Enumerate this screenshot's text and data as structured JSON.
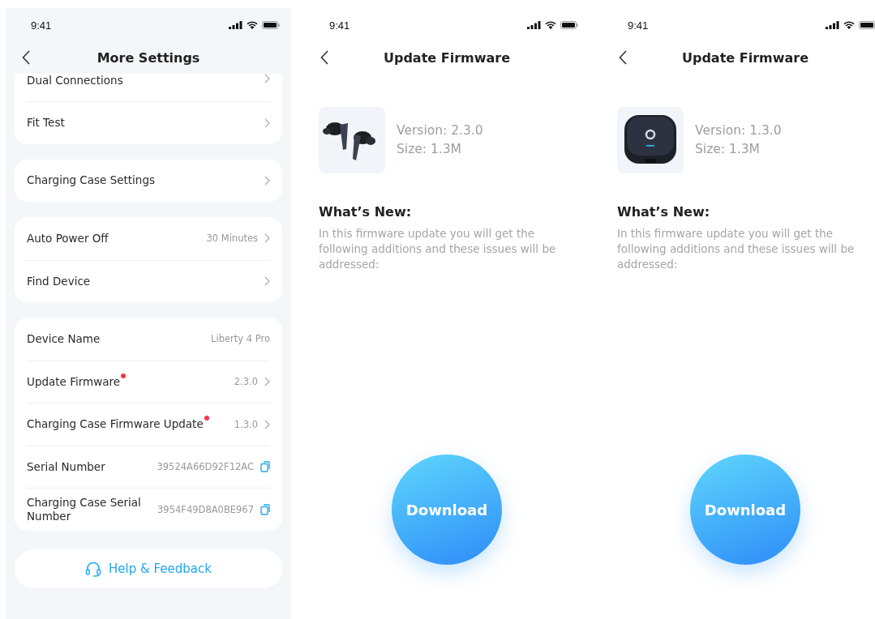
{
  "screens": [
    {
      "kind": "settings",
      "time": "9:41",
      "title": "More Settings",
      "groups": [
        {
          "rows": [
            {
              "kind": "link",
              "label": "Dual Connections",
              "badge": false
            },
            {
              "kind": "link",
              "label": "Fit Test",
              "badge": false
            }
          ]
        },
        {
          "rows": [
            {
              "kind": "link",
              "label": "Charging Case Settings",
              "badge": false
            }
          ]
        },
        {
          "rows": [
            {
              "kind": "link",
              "label": "Auto Power Off",
              "value": "30 Minutes",
              "badge": false
            },
            {
              "kind": "link",
              "label": "Find Device",
              "badge": false
            }
          ]
        },
        {
          "rows": [
            {
              "kind": "value",
              "label": "Device Name",
              "value": "Liberty 4 Pro",
              "badge": false
            },
            {
              "kind": "link",
              "label": "Update Firmware",
              "value": "2.3.0",
              "badge": true
            },
            {
              "kind": "link",
              "label": "Charging Case Firmware Update",
              "value": "1.3.0",
              "badge": true
            },
            {
              "kind": "copy",
              "label": "Serial Number",
              "value": "39524A66D92F12AC",
              "badge": false
            },
            {
              "kind": "copy",
              "label": "Charging Case Serial Number",
              "value": "3954F49D8A0BE967",
              "badge": false
            }
          ]
        }
      ],
      "help_button": "Help & Feedback"
    },
    {
      "kind": "firmware",
      "time": "9:41",
      "title": "Update Firmware",
      "version": "Version: 2.3.0",
      "size": "Size: 1.3M",
      "whats_new_title": "What’s New:",
      "whats_new_body": "In this firmware update you will get the following additions and these issues will be addressed:",
      "download_button": "Download"
    },
    {
      "kind": "firmware",
      "time": "9:41",
      "title": "Update Firmware",
      "version": "Version: 1.3.0",
      "size": "Size: 1.3M",
      "whats_new_title": "What’s New:",
      "whats_new_body": "In this firmware update you will get the following additions and these issues will be addressed:",
      "download_button": "Download"
    }
  ]
}
